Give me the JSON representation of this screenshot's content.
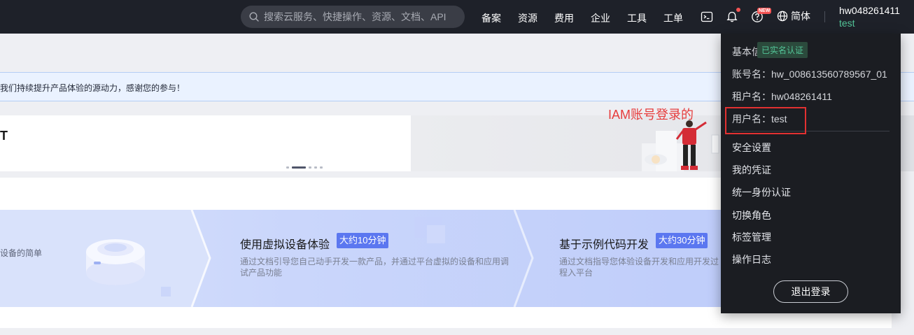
{
  "topbar": {
    "search_placeholder": "搜索云服务、快捷操作、资源、文档、API",
    "nav": [
      "备案",
      "资源",
      "费用",
      "企业",
      "工具",
      "工单"
    ],
    "new_badge": "NEW",
    "language": "简体",
    "account_name": "hw048261411",
    "user_name": "test",
    "icons": [
      "search-icon",
      "cloud-shell-icon",
      "bell-icon",
      "help-icon",
      "globe-icon"
    ]
  },
  "page": {
    "notice_text": "我们持续提升产品体验的源动力，感谢您的参与！",
    "banner_title": "T",
    "annotation": "IAM账号登录的",
    "cards": {
      "left_desc": "设备的简单",
      "virtual": {
        "title": "使用虚拟设备体验",
        "badge": "大约10分钟",
        "desc": "通过文档引导您自己动手开发一款产品，并通过平台虚拟的设备和应用调试产品功能"
      },
      "sample": {
        "title": "基于示例代码开发",
        "badge": "大约30分钟",
        "desc": "通过文档指导您体验设备开发和应用开发过程入平台"
      }
    }
  },
  "dropdown": {
    "basic_info_label": "基本信息",
    "verified_label": "已实名认证",
    "account_no": "账号名：hw_008613560789567_01",
    "tenant_name": "租户名：hw048261411",
    "user_name": "用户名：test",
    "menu": [
      "安全设置",
      "我的凭证",
      "统一身份认证",
      "切换角色",
      "标签管理",
      "操作日志"
    ],
    "logout": "退出登录"
  },
  "colors": {
    "topbar_bg": "#1e2129",
    "dropdown_bg": "#1b1d22",
    "accent_green": "#53c598",
    "annotation_red": "#e23131",
    "badge_blue": "#5b77f0"
  }
}
